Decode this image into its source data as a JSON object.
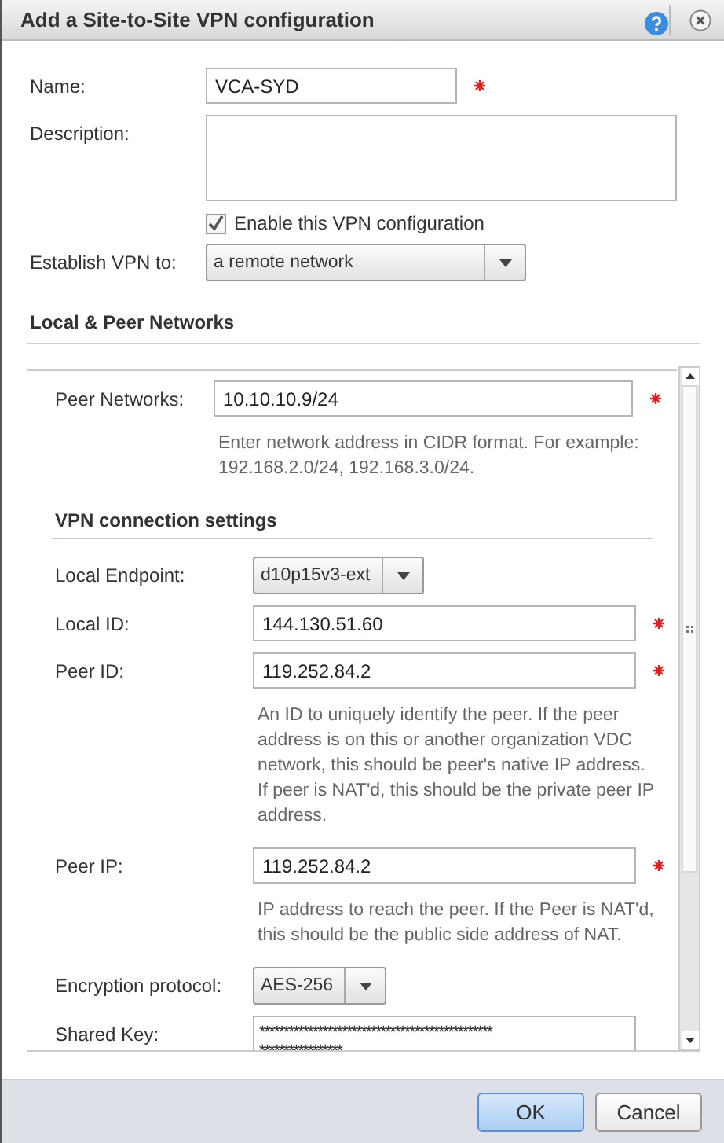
{
  "dialog": {
    "title": "Add a Site-to-Site VPN configuration"
  },
  "top_fields": [
    {
      "kind": "text",
      "label": "Name:",
      "value": "VCA-SYD",
      "required": true
    },
    {
      "kind": "textarea",
      "label": "Description:"
    },
    {
      "kind": "checkbox",
      "label": "Enable this VPN configuration",
      "checked": true
    },
    {
      "kind": "select",
      "label": "Establish VPN to:",
      "value": "a remote network"
    }
  ],
  "section_title": "Local & Peer Networks",
  "scroll_fields": [
    {
      "kind": "text",
      "label": "Peer Networks:",
      "value": "10.10.10.9/24",
      "required": true,
      "help": [
        "Enter network address in CIDR format. For example:",
        "192.168.2.0/24, 192.168.3.0/24."
      ]
    },
    {
      "kind": "heading",
      "label": "VPN connection settings"
    },
    {
      "kind": "select",
      "label": "Local Endpoint:",
      "value": "d10p15v3-ext"
    },
    {
      "kind": "text",
      "label": "Local ID:",
      "value": "144.130.51.60",
      "required": true
    },
    {
      "kind": "text",
      "label": "Peer ID:",
      "value": "119.252.84.2",
      "required": true,
      "help": [
        "An ID to uniquely identify the peer. If the peer",
        "address is on this or another organization VDC",
        "network, this should be peer's native IP address.",
        "If peer is NAT'd, this should be the private peer IP",
        "address."
      ]
    },
    {
      "kind": "text",
      "label": "Peer IP:",
      "value": "119.252.84.2",
      "required": true,
      "help": [
        "IP address to reach the peer. If the Peer is NAT'd,",
        "this should be the public side address of NAT."
      ]
    },
    {
      "kind": "select",
      "label": "Encryption protocol:",
      "value": "AES-256"
    },
    {
      "kind": "textarea",
      "label": "Shared Key:",
      "lines": [
        "************************************************",
        "*****************"
      ]
    }
  ],
  "buttons": [
    {
      "label": "OK",
      "primary": true
    },
    {
      "label": "Cancel",
      "primary": false
    }
  ]
}
